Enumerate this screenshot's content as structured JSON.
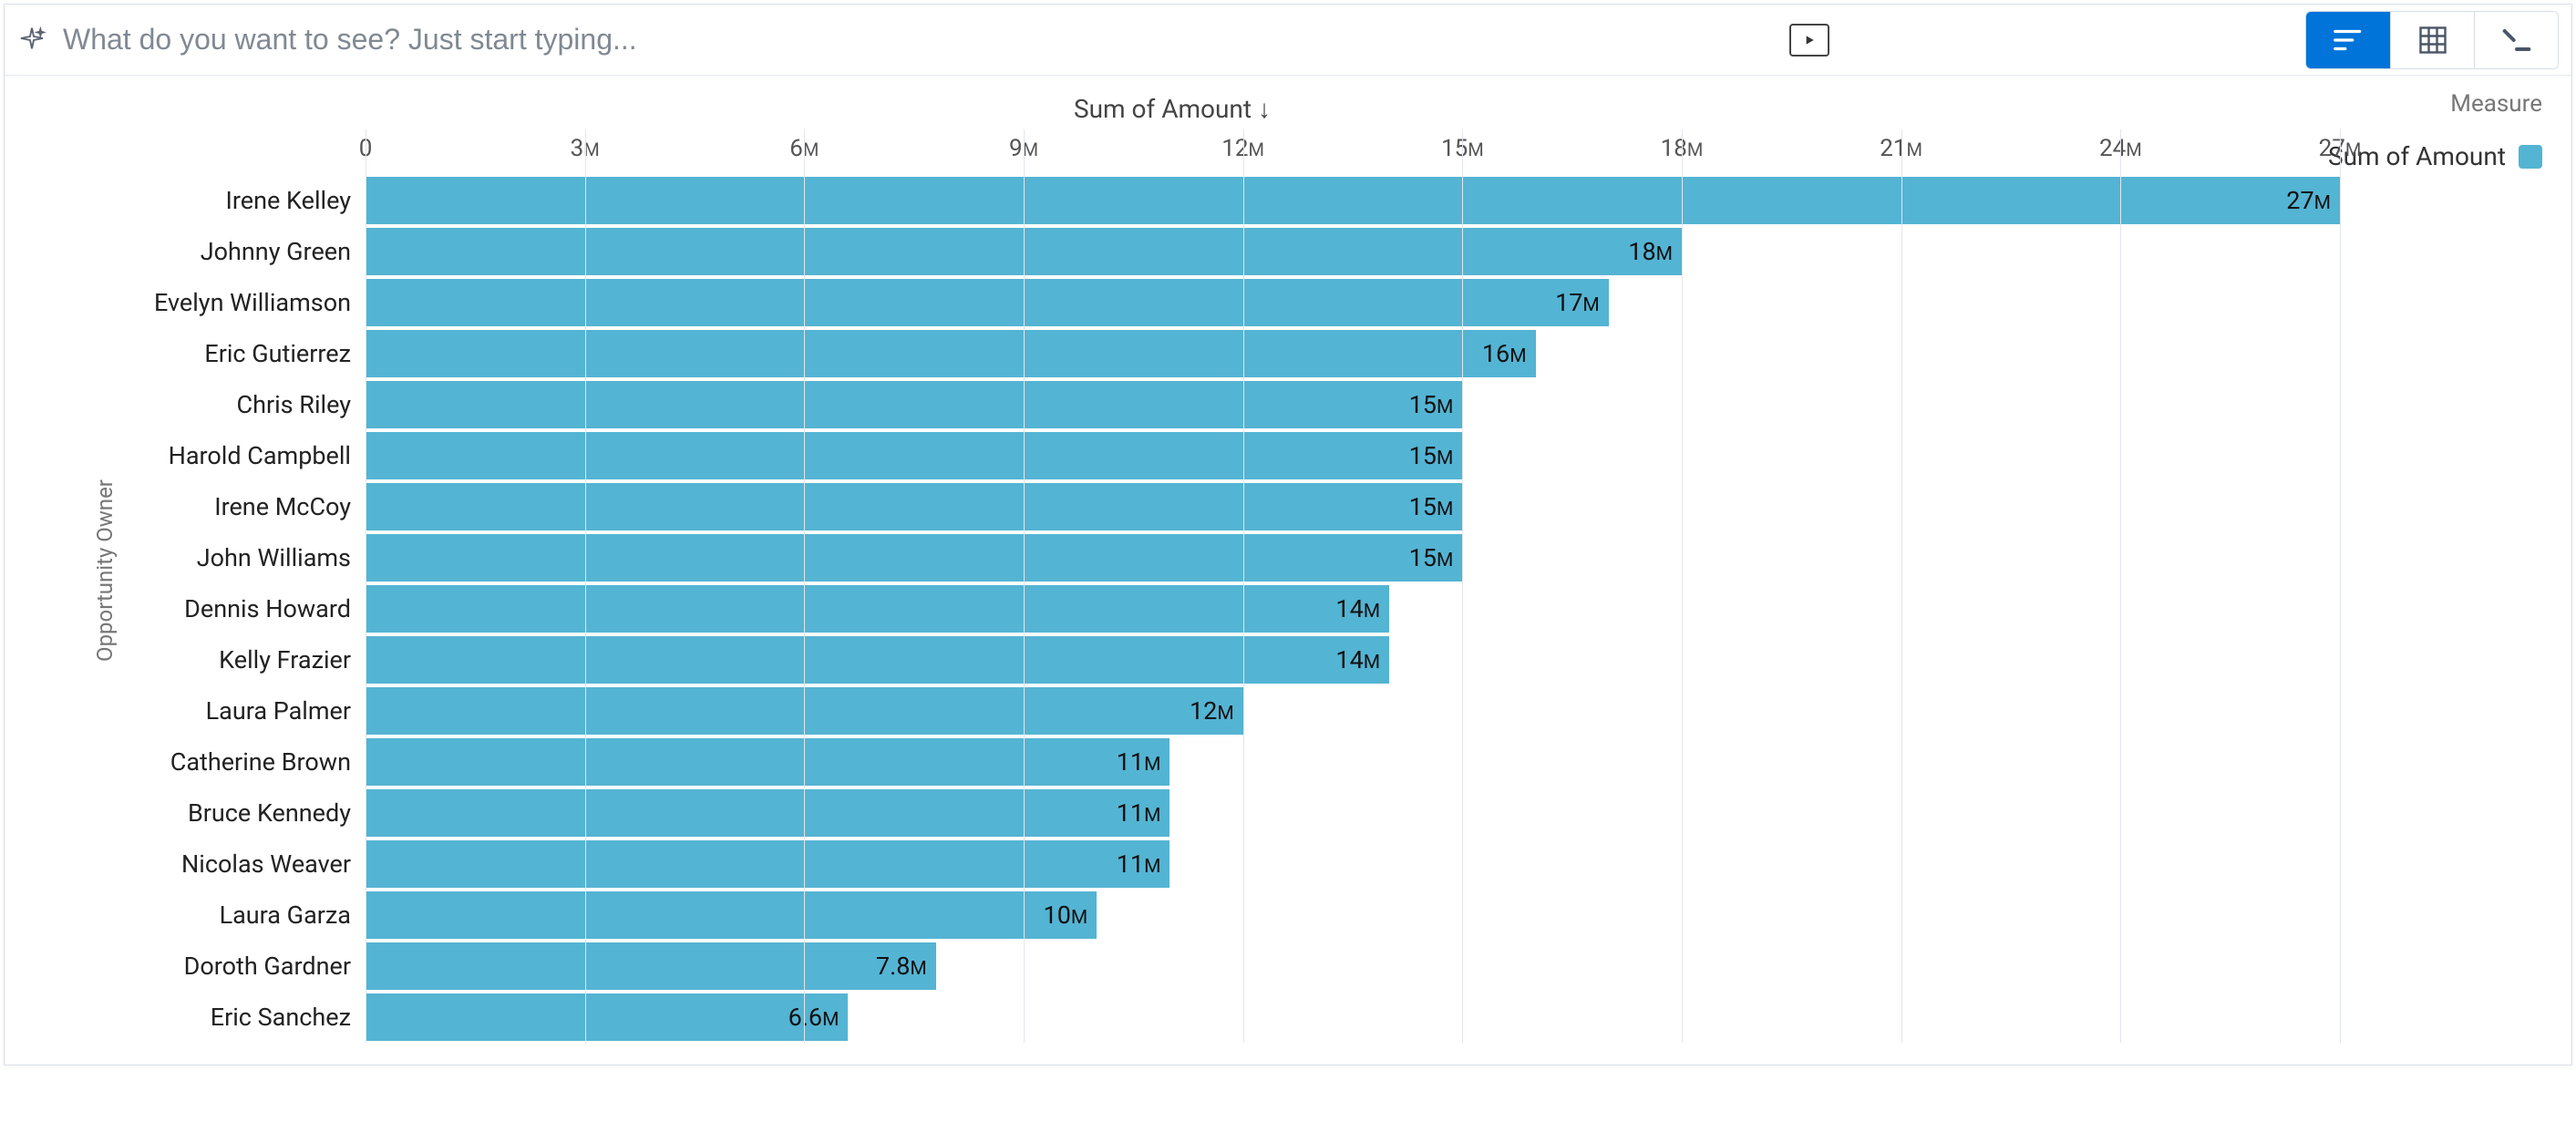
{
  "topbar": {
    "query_placeholder": "What do you want to see? Just start typing...",
    "query_value": ""
  },
  "view_buttons": {
    "chart": "chart-view",
    "table": "table-view",
    "saql": "saql-view"
  },
  "legend": {
    "title": "Measure",
    "item": "Sum of Amount"
  },
  "chart_data": {
    "type": "bar",
    "orientation": "horizontal",
    "title": "Sum of Amount ↓",
    "xlabel": "",
    "ylabel": "Opportunity Owner",
    "xlim": [
      0,
      27000000
    ],
    "x_ticks": [
      {
        "value": 0,
        "label": "0"
      },
      {
        "value": 3000000,
        "label": "3M"
      },
      {
        "value": 6000000,
        "label": "6M"
      },
      {
        "value": 9000000,
        "label": "9M"
      },
      {
        "value": 12000000,
        "label": "12M"
      },
      {
        "value": 15000000,
        "label": "15M"
      },
      {
        "value": 18000000,
        "label": "18M"
      },
      {
        "value": 21000000,
        "label": "21M"
      },
      {
        "value": 24000000,
        "label": "24M"
      },
      {
        "value": 27000000,
        "label": "27M"
      }
    ],
    "series": [
      {
        "name": "Sum of Amount",
        "color": "#54b4d3",
        "data": [
          {
            "category": "Irene Kelley",
            "value": 27000000,
            "label": "27M"
          },
          {
            "category": "Johnny Green",
            "value": 18000000,
            "label": "18M"
          },
          {
            "category": "Evelyn Williamson",
            "value": 17000000,
            "label": "17M"
          },
          {
            "category": "Eric Gutierrez",
            "value": 16000000,
            "label": "16M"
          },
          {
            "category": "Chris Riley",
            "value": 15000000,
            "label": "15M"
          },
          {
            "category": "Harold Campbell",
            "value": 15000000,
            "label": "15M"
          },
          {
            "category": "Irene McCoy",
            "value": 15000000,
            "label": "15M"
          },
          {
            "category": "John Williams",
            "value": 15000000,
            "label": "15M"
          },
          {
            "category": "Dennis Howard",
            "value": 14000000,
            "label": "14M"
          },
          {
            "category": "Kelly Frazier",
            "value": 14000000,
            "label": "14M"
          },
          {
            "category": "Laura Palmer",
            "value": 12000000,
            "label": "12M"
          },
          {
            "category": "Catherine Brown",
            "value": 11000000,
            "label": "11M"
          },
          {
            "category": "Bruce Kennedy",
            "value": 11000000,
            "label": "11M"
          },
          {
            "category": "Nicolas Weaver",
            "value": 11000000,
            "label": "11M"
          },
          {
            "category": "Laura Garza",
            "value": 10000000,
            "label": "10M"
          },
          {
            "category": "Doroth Gardner",
            "value": 7800000,
            "label": "7.8M"
          },
          {
            "category": "Eric Sanchez",
            "value": 6600000,
            "label": "6.6M"
          }
        ]
      }
    ]
  }
}
